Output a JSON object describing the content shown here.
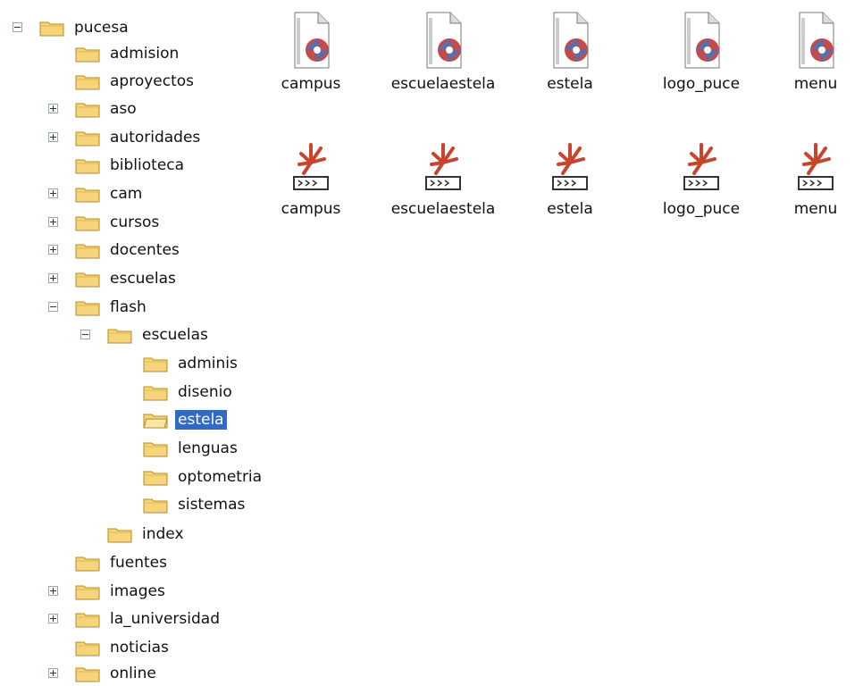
{
  "tree": {
    "rows": [
      {
        "label": "pucesa",
        "expander": "minus"
      },
      {
        "label": "admision",
        "expander": ""
      },
      {
        "label": "aproyectos",
        "expander": ""
      },
      {
        "label": "aso",
        "expander": "plus"
      },
      {
        "label": "autoridades",
        "expander": "plus"
      },
      {
        "label": "biblioteca",
        "expander": ""
      },
      {
        "label": "cam",
        "expander": "plus"
      },
      {
        "label": "cursos",
        "expander": "plus"
      },
      {
        "label": "docentes",
        "expander": "plus"
      },
      {
        "label": "escuelas",
        "expander": "plus"
      },
      {
        "label": "flash",
        "expander": "minus"
      },
      {
        "label": "escuelas",
        "expander": "minus"
      },
      {
        "label": "adminis",
        "expander": ""
      },
      {
        "label": "disenio",
        "expander": ""
      },
      {
        "label": "estela",
        "expander": "",
        "selected": true
      },
      {
        "label": "lenguas",
        "expander": ""
      },
      {
        "label": "optometria",
        "expander": ""
      },
      {
        "label": "sistemas",
        "expander": ""
      },
      {
        "label": "index",
        "expander": ""
      },
      {
        "label": "fuentes",
        "expander": ""
      },
      {
        "label": "images",
        "expander": "plus"
      },
      {
        "label": "la_universidad",
        "expander": "plus"
      },
      {
        "label": "noticias",
        "expander": ""
      },
      {
        "label": "online",
        "expander": "plus"
      }
    ]
  },
  "files": {
    "fla": [
      "campus",
      "escuelaestela",
      "estela",
      "logo_puce",
      "menu"
    ],
    "swf": [
      "campus",
      "escuelaestela",
      "estela",
      "logo_puce",
      "menu"
    ]
  },
  "colors": {
    "folder": "#f5d47a",
    "folder_edge": "#b58a2a",
    "selection": "#3169c6"
  }
}
